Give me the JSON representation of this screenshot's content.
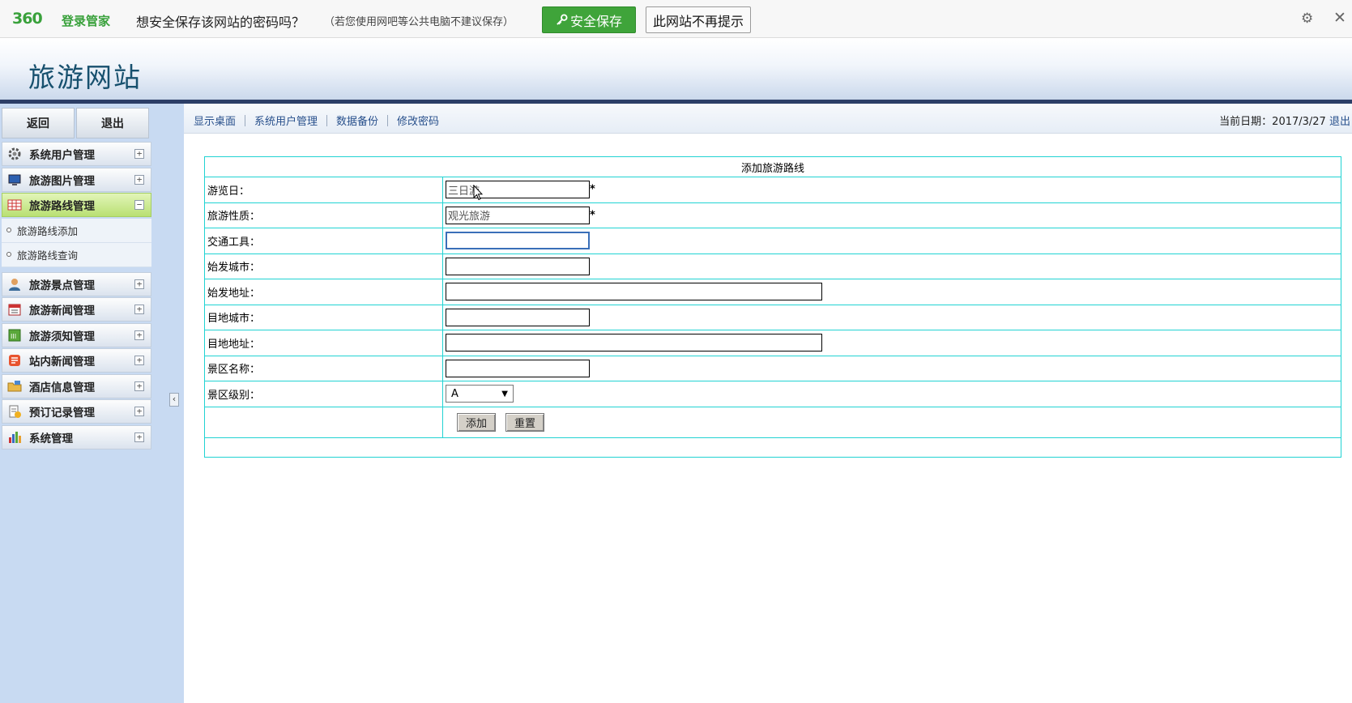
{
  "password_bar": {
    "logo": "360",
    "logo_sub": "登录管家",
    "question": "想安全保存该网站的密码吗？",
    "hint": "（若您使用网吧等公共电脑不建议保存）",
    "save_label": "安全保存",
    "nomore_label": "此网站不再提示",
    "gear_icon": "gear-icon",
    "close_icon": "close-icon"
  },
  "header": {
    "site_title": "旅游网站"
  },
  "sidebar": {
    "back_label": "返回",
    "exit_label": "退出",
    "menu": [
      {
        "label": "系统用户管理",
        "icon": "gear-icon",
        "state": "collapsed"
      },
      {
        "label": "旅游图片管理",
        "icon": "monitor-icon",
        "state": "collapsed"
      },
      {
        "label": "旅游路线管理",
        "icon": "table-icon",
        "state": "expanded"
      },
      {
        "label": "旅游景点管理",
        "icon": "person-icon",
        "state": "collapsed"
      },
      {
        "label": "旅游新闻管理",
        "icon": "calendar-icon",
        "state": "collapsed"
      },
      {
        "label": "旅游须知管理",
        "icon": "note-icon",
        "state": "collapsed"
      },
      {
        "label": "站内新闻管理",
        "icon": "news-icon",
        "state": "collapsed"
      },
      {
        "label": "酒店信息管理",
        "icon": "folder-icon",
        "state": "collapsed"
      },
      {
        "label": "预订记录管理",
        "icon": "clipboard-icon",
        "state": "collapsed"
      },
      {
        "label": "系统管理",
        "icon": "bar-chart-icon",
        "state": "collapsed"
      }
    ],
    "submenu": [
      {
        "label": "旅游路线添加"
      },
      {
        "label": "旅游路线查询"
      }
    ]
  },
  "topnav": {
    "links": [
      "显示桌面",
      "系统用户管理",
      "数据备份",
      "修改密码"
    ],
    "date_text": "当前日期：2017/3/27",
    "logout_label": "退出"
  },
  "form": {
    "caption": "添加旅游路线",
    "fields": [
      {
        "label": "游览日：",
        "value": "三日游",
        "required": "*"
      },
      {
        "label": "旅游性质：",
        "value": "观光旅游",
        "required": "*"
      },
      {
        "label": "交通工具：",
        "value": ""
      },
      {
        "label": "始发城市：",
        "value": ""
      },
      {
        "label": "始发地址：",
        "value": ""
      },
      {
        "label": "目地城市：",
        "value": ""
      },
      {
        "label": "目地地址：",
        "value": ""
      },
      {
        "label": "景区名称：",
        "value": ""
      },
      {
        "label": "景区级别：",
        "value": "A"
      }
    ],
    "add_label": "添加",
    "reset_label": "重置"
  }
}
